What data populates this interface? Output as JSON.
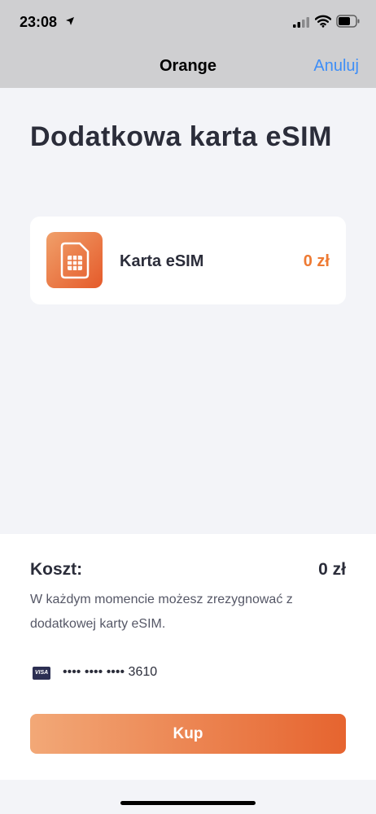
{
  "status_bar": {
    "time": "23:08",
    "icons": [
      "location-arrow-icon",
      "signal-icon",
      "wifi-icon",
      "battery-icon"
    ]
  },
  "nav": {
    "title": "Orange",
    "cancel_label": "Anuluj"
  },
  "page": {
    "title": "Dodatkowa karta eSIM"
  },
  "item": {
    "icon": "sim-card-icon",
    "label": "Karta eSIM",
    "price": "0 zł"
  },
  "summary": {
    "cost_label": "Koszt:",
    "cost_value": "0 zł",
    "note": "W każdym momencie możesz zrezygnować z dodatkowej karty eSIM."
  },
  "payment": {
    "card_brand": "VISA",
    "card_number": "•••• •••• •••• 3610"
  },
  "actions": {
    "buy_label": "Kup"
  },
  "colors": {
    "accent_orange": "#ee7a33",
    "link_blue": "#3e8ef7",
    "text_dark": "#2b2d3a"
  }
}
